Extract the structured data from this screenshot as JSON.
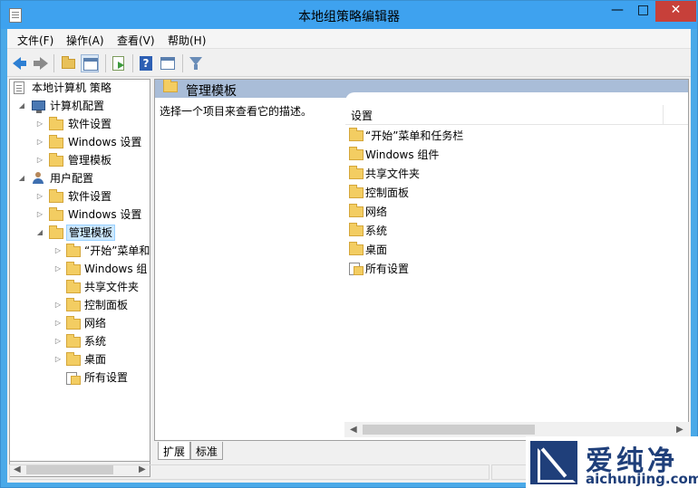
{
  "window": {
    "title": "本地组策略编辑器",
    "min_glyph": "—",
    "max_glyph": "□",
    "close_glyph": "✕"
  },
  "menu": [
    {
      "label": "文件(F)"
    },
    {
      "label": "操作(A)"
    },
    {
      "label": "查看(V)"
    },
    {
      "label": "帮助(H)"
    }
  ],
  "toolbar": {
    "back_icon": "arrow-left-icon",
    "forward_icon": "arrow-right-icon",
    "up_icon": "folder-up-icon",
    "console_icon": "show-hide-tree-icon",
    "export_icon": "export-list-icon",
    "help_label": "?",
    "props_icon": "properties-icon",
    "filter_icon": "filter-icon"
  },
  "tree": {
    "root": "本地计算机 策略",
    "computer": "计算机配置",
    "computer_children": [
      "软件设置",
      "Windows 设置",
      "管理模板"
    ],
    "user": "用户配置",
    "user_children": [
      "软件设置",
      "Windows 设置",
      "管理模板"
    ],
    "admin_children": [
      "“开始”菜单和",
      "Windows 组",
      "共享文件夹",
      "控制面板",
      "网络",
      "系统",
      "桌面",
      "所有设置"
    ]
  },
  "header": {
    "title": "管理模板"
  },
  "description": "选择一个项目来查看它的描述。",
  "list": {
    "column": "设置",
    "items": [
      {
        "label": "“开始”菜单和任务栏",
        "icon": "folder-icon"
      },
      {
        "label": "Windows 组件",
        "icon": "folder-icon"
      },
      {
        "label": "共享文件夹",
        "icon": "folder-icon"
      },
      {
        "label": "控制面板",
        "icon": "folder-icon"
      },
      {
        "label": "网络",
        "icon": "folder-icon"
      },
      {
        "label": "系统",
        "icon": "folder-icon"
      },
      {
        "label": "桌面",
        "icon": "folder-icon"
      },
      {
        "label": "所有设置",
        "icon": "settings-icon"
      }
    ]
  },
  "tabs": [
    {
      "label": "扩展"
    },
    {
      "label": "标准"
    }
  ],
  "watermark": {
    "title": "爱纯净",
    "url": "aichunjing.com"
  },
  "colors": {
    "titlebar": "#3ea2ef",
    "close": "#c7403a",
    "header_band": "#a9bdd8",
    "selection": "#cce8ff",
    "folder": "#f3cd62",
    "brand": "#1f3f7a"
  }
}
